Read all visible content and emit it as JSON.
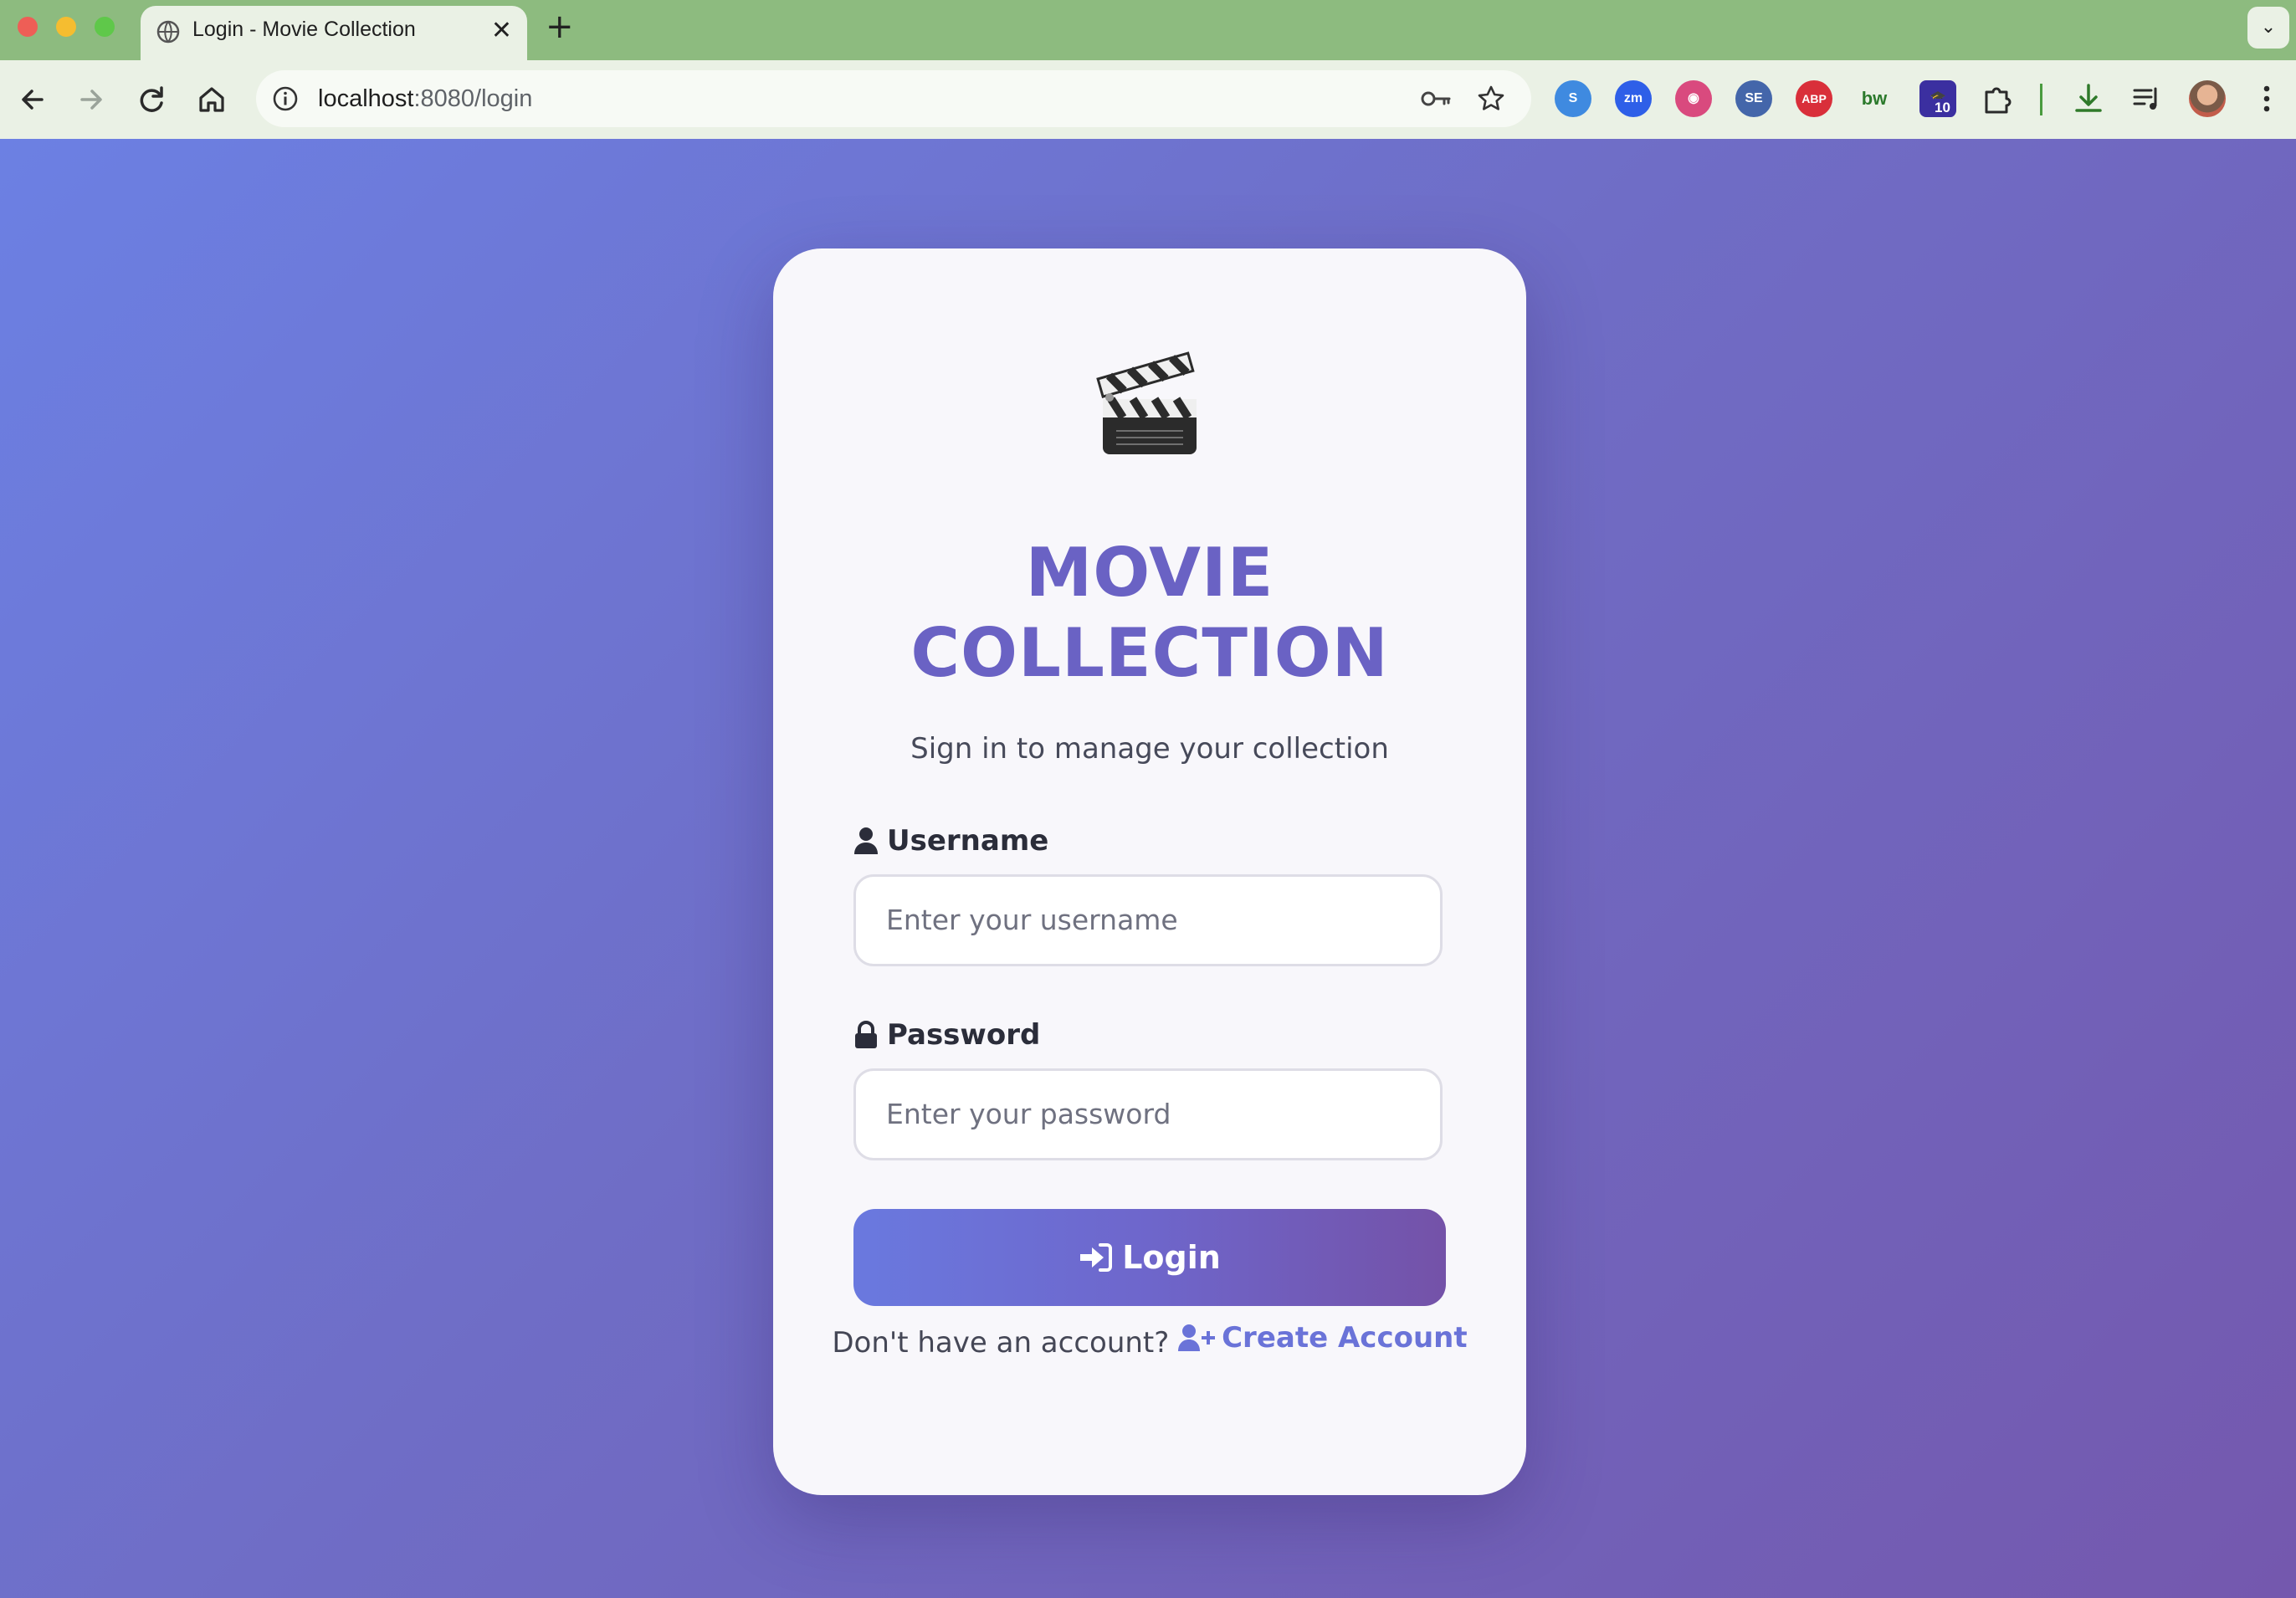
{
  "browser": {
    "tab_title": "Login - Movie Collection",
    "url_host": "localhost",
    "url_rest": ":8080/login",
    "extension_badge": "10"
  },
  "card": {
    "title_line1": "MOVIE",
    "title_line2": "COLLECTION",
    "subtitle": "Sign in to manage your collection",
    "username_label": "Username",
    "username_placeholder": "Enter your username",
    "password_label": "Password",
    "password_placeholder": "Enter your password",
    "login_label": "Login",
    "footer_text": "Don't have an account?",
    "create_account_label": "Create Account"
  },
  "colors": {
    "accent": "#6a62c4",
    "button_start": "#6a79df",
    "button_end": "#7452a8",
    "link": "#6a73d8",
    "tab_strip": "#8dbb7f"
  },
  "icons": {
    "logo": "clapperboard-icon",
    "username": "user-icon",
    "password": "lock-icon",
    "login": "sign-in-icon",
    "create_account": "user-plus-icon"
  }
}
